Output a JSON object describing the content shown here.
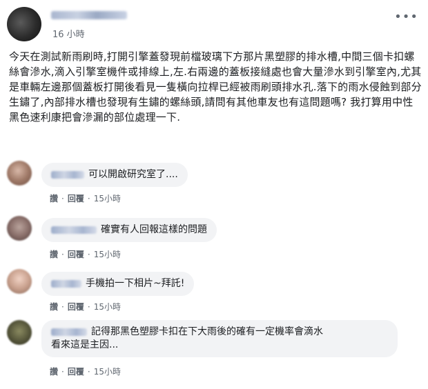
{
  "post": {
    "time": "16 小時",
    "more_label": "•••",
    "text": "今天在測試新雨刷時,打開引擎蓋發現前檔玻璃下方那片黑塑膠的排水槽,中間三個卡扣螺絲會滲水,滴入引擎室機件或排線上,左.右兩邊的蓋板接縫處也會大量滲水到引擎室內,尤其是車輛左邊那個蓋板打開後看見一隻橫向拉桿已經被雨刷頭排水孔.落下的雨水侵蝕到部分生鏽了,內部排水槽也發現有生鏽的螺絲頭,請問有其他車友也有這問題嗎? 我打算用中性黑色速利康把會滲漏的部位處理一下."
  },
  "comments": [
    {
      "text": "可以開啟研究室了....",
      "like_label": "讚",
      "reply_label": "回覆",
      "time": "15小時"
    },
    {
      "text": "確實有人回報這樣的問題",
      "like_label": "讚",
      "reply_label": "回覆",
      "time": "15小時"
    },
    {
      "text": "手機拍一下相片~拜託!",
      "like_label": "讚",
      "reply_label": "回覆",
      "time": "15小時"
    },
    {
      "text_line1": "記得那黑色塑膠卡扣在下大雨後的確有一定機率會滴水",
      "text_line2": "看來這是主因...",
      "like_label": "讚",
      "reply_label": "回覆",
      "time": "15小時"
    }
  ],
  "colors": {
    "bubble_bg": "#f2f3f5",
    "meta_text": "#606770",
    "body_text": "#1c1e21"
  }
}
